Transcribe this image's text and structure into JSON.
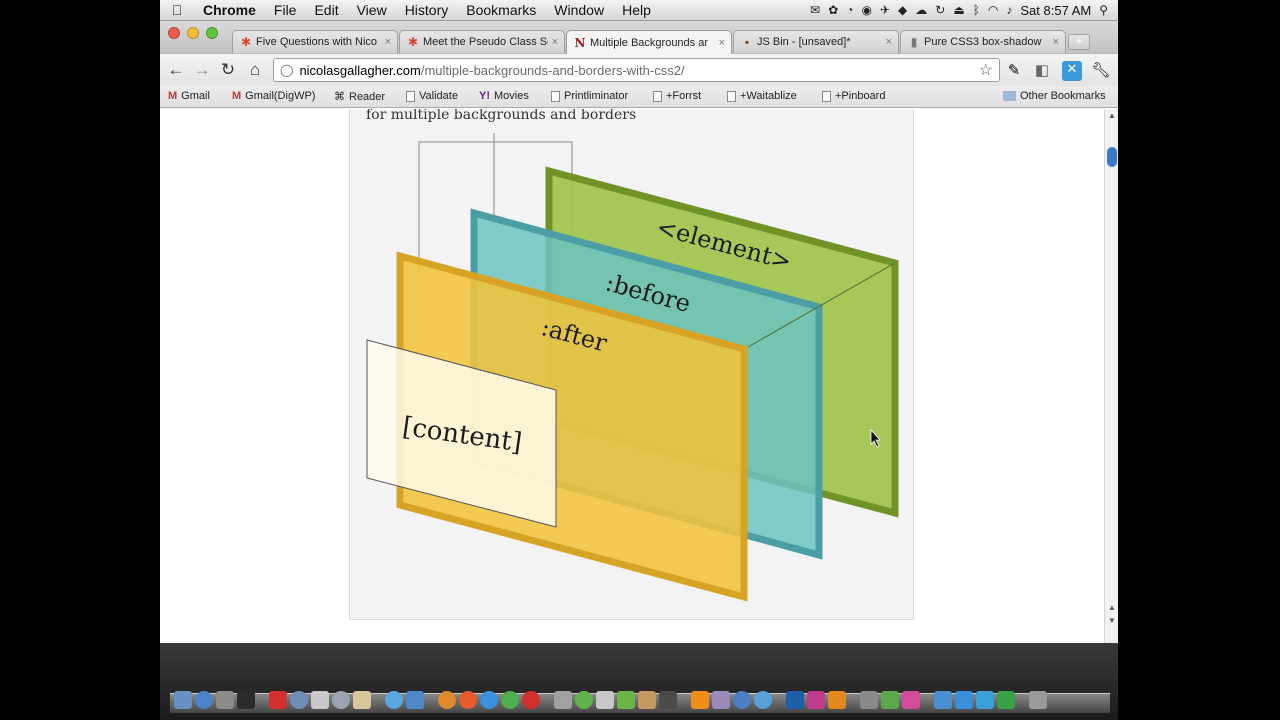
{
  "menubar": {
    "apple": "",
    "items": [
      "Chrome",
      "File",
      "Edit",
      "View",
      "History",
      "Bookmarks",
      "Window",
      "Help"
    ],
    "clock": "Sat 8:57 AM"
  },
  "tabs": [
    {
      "title": "Five Questions with Nico",
      "favicon": "✱",
      "favicon_color": "#e0452f"
    },
    {
      "title": "Meet the Pseudo Class Se",
      "favicon": "✱",
      "favicon_color": "#e0452f"
    },
    {
      "title": "Multiple Backgrounds ar",
      "favicon": "N",
      "favicon_color": "#9b1c1c"
    },
    {
      "title": "JS Bin - [unsaved]*",
      "favicon": "▪",
      "favicon_color": "#7a4a22"
    },
    {
      "title": "Pure CSS3 box-shadow",
      "favicon": "▮",
      "favicon_color": "#777777"
    }
  ],
  "tab_close": "×",
  "new_tab": "+",
  "toolbar": {
    "back": "←",
    "forward": "→",
    "reload": "↻",
    "home": "⌂",
    "url_host": "nicolasgallagher.com",
    "url_path": "/multiple-backgrounds-and-borders-with-css2/",
    "star": "☆"
  },
  "bookmarks": [
    {
      "label": "Gmail",
      "icon": "M",
      "kind": "gmail"
    },
    {
      "label": "Gmail(DigWP)",
      "icon": "M",
      "kind": "gmail"
    },
    {
      "label": "Reader",
      "icon": "⌘",
      "kind": "plain"
    },
    {
      "label": "Validate",
      "icon": "",
      "kind": "doc"
    },
    {
      "label": "Movies",
      "icon": "Y!",
      "kind": "yahoo"
    },
    {
      "label": "Printliminator",
      "icon": "",
      "kind": "doc"
    },
    {
      "label": "+Forrst",
      "icon": "",
      "kind": "doc"
    },
    {
      "label": "+Waitablize",
      "icon": "",
      "kind": "doc"
    },
    {
      "label": "+Pinboard",
      "icon": "",
      "kind": "doc"
    }
  ],
  "other_bookmarks": "Other Bookmarks",
  "figure": {
    "caption": "for multiple backgrounds and  borders",
    "layers": [
      {
        "label": "<element>",
        "fill": "#9cc243",
        "stroke": "#6f9327"
      },
      {
        "label": ":before",
        "fill": "#6cc3c1",
        "stroke": "#4a9ea4"
      },
      {
        "label": ":after",
        "fill": "#f1c33b",
        "stroke": "#d6a325"
      },
      {
        "label": "[content]",
        "fill": "#fffbea",
        "stroke": "#555555"
      }
    ]
  },
  "colors": {
    "accent": "#3b78c8"
  }
}
